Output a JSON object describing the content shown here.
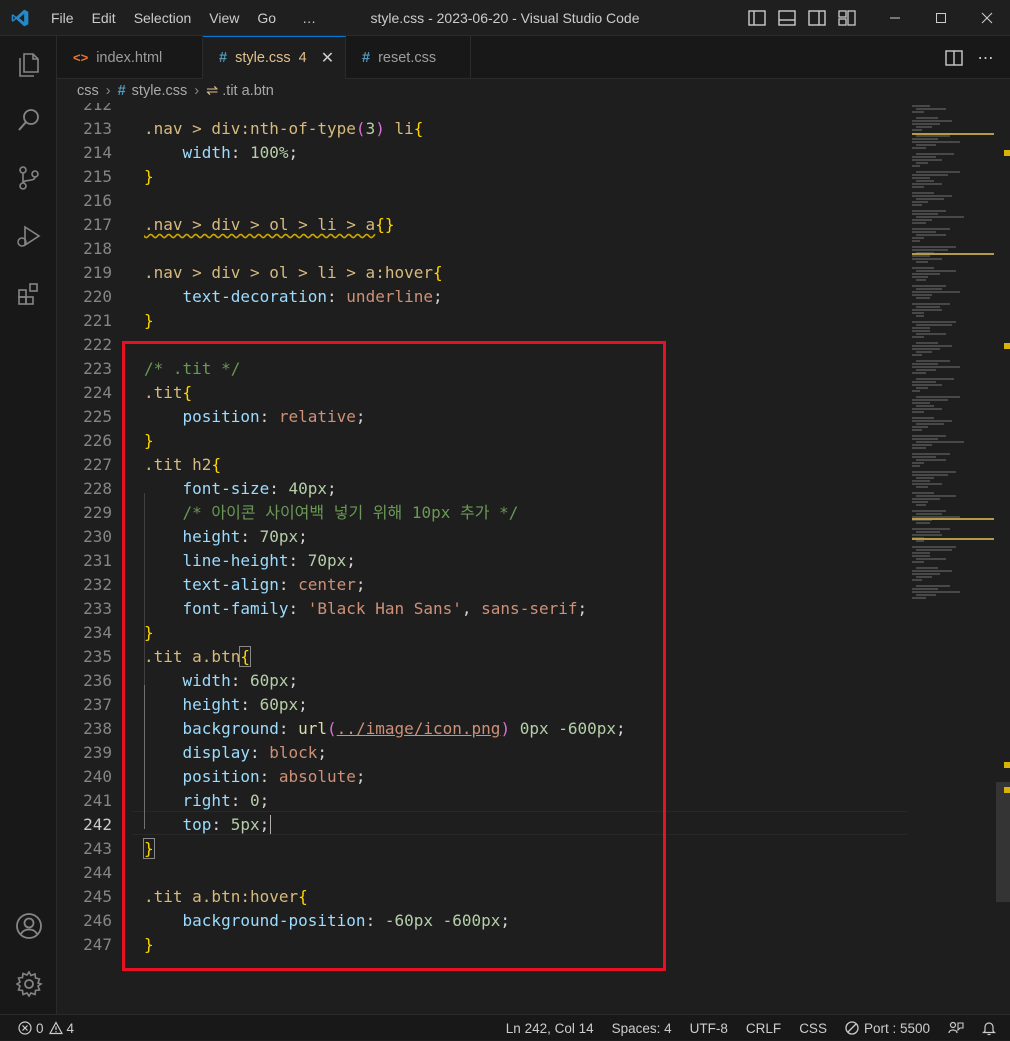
{
  "window": {
    "title": "style.css - 2023-06-20 - Visual Studio Code",
    "menu": [
      "File",
      "Edit",
      "Selection",
      "View",
      "Go",
      "…"
    ]
  },
  "tabs": [
    {
      "label": "index.html",
      "icon": "<>",
      "icon_color": "#e37933",
      "active": false
    },
    {
      "label": "style.css",
      "icon": "#",
      "icon_color": "#519aba",
      "count": "4",
      "active": true
    },
    {
      "label": "reset.css",
      "icon": "#",
      "icon_color": "#519aba",
      "active": false
    }
  ],
  "breadcrumb": {
    "folder": "css",
    "file": "style.css",
    "symbol": ".tit a.btn"
  },
  "editor": {
    "partial_line": "212",
    "lines": [
      {
        "n": "213"
      },
      {
        "n": "214"
      },
      {
        "n": "215"
      },
      {
        "n": "216"
      },
      {
        "n": "217"
      },
      {
        "n": "218"
      },
      {
        "n": "219"
      },
      {
        "n": "220"
      },
      {
        "n": "221"
      },
      {
        "n": "222"
      },
      {
        "n": "223"
      },
      {
        "n": "224"
      },
      {
        "n": "225"
      },
      {
        "n": "226"
      },
      {
        "n": "227"
      },
      {
        "n": "228"
      },
      {
        "n": "229"
      },
      {
        "n": "230"
      },
      {
        "n": "231"
      },
      {
        "n": "232"
      },
      {
        "n": "233"
      },
      {
        "n": "234"
      },
      {
        "n": "235"
      },
      {
        "n": "236"
      },
      {
        "n": "237"
      },
      {
        "n": "238"
      },
      {
        "n": "239"
      },
      {
        "n": "240"
      },
      {
        "n": "241"
      },
      {
        "n": "242"
      },
      {
        "n": "243"
      },
      {
        "n": "244"
      },
      {
        "n": "245"
      },
      {
        "n": "246"
      },
      {
        "n": "247"
      }
    ],
    "code": {
      "l213": {
        "sel": ".nav > div:nth-of-type",
        "arg": "3",
        "sel2": " li"
      },
      "l214": {
        "prop": "width",
        "val": "100%"
      },
      "l217": {
        "sel": ".nav > div > ol > li > a"
      },
      "l219": {
        "sel": ".nav > div > ol > li > a:hover"
      },
      "l220": {
        "prop": "text-decoration",
        "val": "underline"
      },
      "l223": {
        "comment": "/* .tit */"
      },
      "l224": {
        "sel": ".tit"
      },
      "l225": {
        "prop": "position",
        "val": "relative"
      },
      "l227": {
        "sel": ".tit h2"
      },
      "l228": {
        "prop": "font-size",
        "val": "40px"
      },
      "l229": {
        "comment": "/* 아이콘 사이여백 넣기 위해 10px 추가 */"
      },
      "l230": {
        "prop": "height",
        "val": "70px"
      },
      "l231": {
        "prop": "line-height",
        "val": "70px"
      },
      "l232": {
        "prop": "text-align",
        "val": "center"
      },
      "l233": {
        "prop": "font-family",
        "val1": "'Black Han Sans'",
        "val2": "sans-serif"
      },
      "l235": {
        "sel": ".tit a.btn"
      },
      "l236": {
        "prop": "width",
        "val": "60px"
      },
      "l237": {
        "prop": "height",
        "val": "60px"
      },
      "l238": {
        "prop": "background",
        "fn": "url",
        "url": "../image/icon.png",
        "rest": "0px -600px"
      },
      "l239": {
        "prop": "display",
        "val": "block"
      },
      "l240": {
        "prop": "position",
        "val": "absolute"
      },
      "l241": {
        "prop": "right",
        "val": "0"
      },
      "l242": {
        "prop": "top",
        "val": "5px"
      },
      "l245": {
        "sel": ".tit a.btn:hover"
      },
      "l246": {
        "prop": "background-position",
        "val": "-60px -600px"
      }
    }
  },
  "statusbar": {
    "errors": "0",
    "warnings": "4",
    "position": "Ln 242, Col 14",
    "spaces": "Spaces: 4",
    "encoding": "UTF-8",
    "eol": "CRLF",
    "language": "CSS",
    "port": "Port : 5500"
  },
  "icons": {
    "activity": [
      "explorer-icon",
      "search-icon",
      "source-control-icon",
      "run-debug-icon",
      "extensions-icon",
      "account-icon",
      "settings-gear-icon"
    ]
  },
  "colors": {
    "highlight_box": "#e81123",
    "accent": "#0078d4",
    "warning": "#cca700"
  }
}
